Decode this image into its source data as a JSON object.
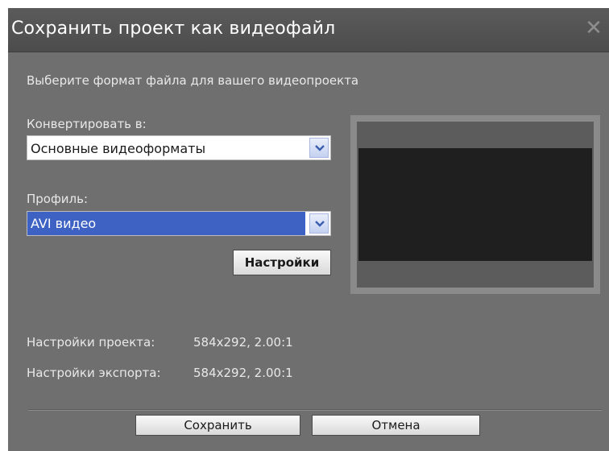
{
  "window": {
    "title": "Сохранить проект как видеофайл",
    "close_icon": "close-icon"
  },
  "main": {
    "instruction": "Выберите формат файла для вашего видеопроекта",
    "convert_label": "Конвертировать в:",
    "convert_value": "Основные видеоформаты",
    "profile_label": "Профиль:",
    "profile_value": "AVI видео",
    "settings_button": "Настройки"
  },
  "info": {
    "project_settings_label": "Настройки проекта:",
    "project_settings_value": "584x292, 2.00:1",
    "export_settings_label": "Настройки экспорта:",
    "export_settings_value": "584x292, 2.00:1"
  },
  "footer": {
    "save_button": "Сохранить",
    "cancel_button": "Отмена"
  },
  "colors": {
    "dialog_background": "#6f6f6f",
    "title_bar": "#4c4c4c",
    "selection": "#3d62c4"
  }
}
